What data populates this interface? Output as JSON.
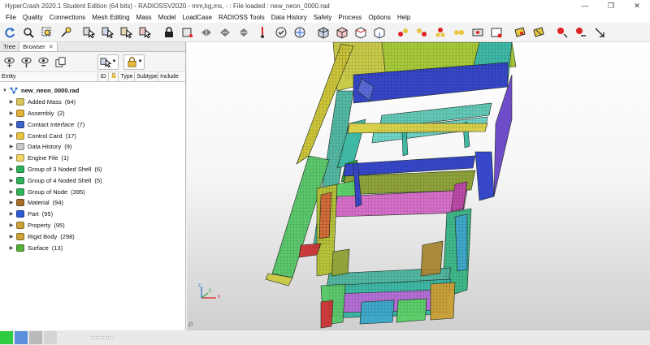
{
  "window": {
    "title": "HyperCrash 2020.1 Student Edition (64 bits) - RADIOSSV2020 - mm,kg,ms, - : File loaded : new_neon_0000.rad",
    "minimize": "—",
    "maximize": "❐",
    "close": "✕"
  },
  "menu": [
    "File",
    "Quality",
    "Connections",
    "Mesh Editing",
    "Mass",
    "Model",
    "LoadCase",
    "RADIOSS Tools",
    "Data History",
    "Safety",
    "Process",
    "Options",
    "Help"
  ],
  "panel": {
    "tabs": [
      "Tree",
      "Browser"
    ],
    "tab_close": "✕",
    "columns": [
      "Entity",
      "ID",
      "Type",
      "Subtype",
      "Include"
    ],
    "tree": {
      "root": "new_neon_0000.rad",
      "items": [
        {
          "label": "Added Mass",
          "count": "(64)",
          "icon_color": "#d9c55a"
        },
        {
          "label": "Assembly",
          "count": "(2)",
          "icon_color": "#e2b43a"
        },
        {
          "label": "Contact Interface",
          "count": "(7)",
          "icon_color": "#3a62c9"
        },
        {
          "label": "Control Card",
          "count": "(17)",
          "icon_color": "#e8c640"
        },
        {
          "label": "Data History",
          "count": "(9)",
          "icon_color": "#c9c9c9"
        },
        {
          "label": "Engine File",
          "count": "(1)",
          "icon_color": "#f1d562"
        },
        {
          "label": "Group of 3 Noded Shell",
          "count": "(6)",
          "icon_color": "#2fb35a"
        },
        {
          "label": "Group of 4 Noded Shell",
          "count": "(5)",
          "icon_color": "#2fb35a"
        },
        {
          "label": "Group of Node",
          "count": "(395)",
          "icon_color": "#2fb35a"
        },
        {
          "label": "Material",
          "count": "(94)",
          "icon_color": "#a86d2a"
        },
        {
          "label": "Part",
          "count": "(95)",
          "icon_color": "#2c5bd1"
        },
        {
          "label": "Property",
          "count": "(95)",
          "icon_color": "#cfa33a"
        },
        {
          "label": "Rigid Body",
          "count": "(298)",
          "icon_color": "#cfa33a"
        },
        {
          "label": "Surface",
          "count": "(13)",
          "icon_color": "#5ab13a"
        }
      ]
    }
  },
  "viewport": {
    "label": "P",
    "triad": [
      "x",
      "y",
      "z"
    ]
  },
  "colors": {
    "accent": "#0078d7",
    "status_green": "#2ecc40",
    "status_blue": "#5b8fdc"
  }
}
